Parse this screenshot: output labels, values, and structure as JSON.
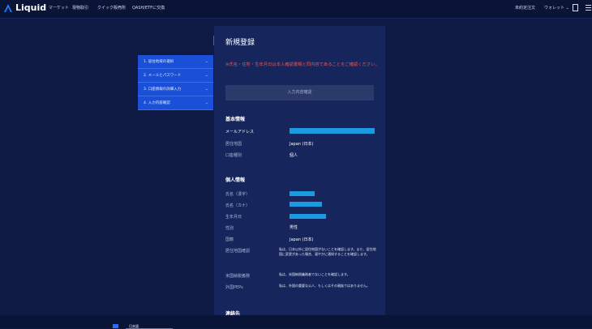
{
  "header": {
    "logo_text": "Liquid",
    "nav": [
      "マーケット",
      "現物取引",
      "クイック販売所",
      "QASH/ETFに交換"
    ],
    "right": {
      "orders": "未約定注文",
      "wallet": "ウォレット"
    }
  },
  "steps": [
    "1. 居住地域の選択",
    "2. メールとパスワード",
    "3. 口座情報の詳細入力",
    "4. 入力内容確認"
  ],
  "form": {
    "title": "新規登録",
    "warning": "※氏名・住所・生年月日は本人確認書類と同内容であることをご確認ください。",
    "confirm_button": "入力内容確認",
    "basic_section": "基本情報",
    "basic": {
      "email_label": "メールアドレス",
      "residence_label": "居住地国",
      "residence_value": "Japan (日本)",
      "account_type_label": "口座種別",
      "account_type_value": "個人"
    },
    "personal_section": "個人情報",
    "personal": {
      "name_kanji_label": "氏名（漢字）",
      "name_kana_label": "氏名（カナ）",
      "birthdate_label": "生年月日",
      "gender_label": "性別",
      "gender_value": "男性",
      "nationality_label": "国籍",
      "nationality_value": "Japan (日本)",
      "residence_confirm_label": "居住地国確認",
      "residence_confirm_text": "私は、日本以外に居住地国がないことを確認します。また、居住地国に変更があった場合、速やかに通知することを確認します。",
      "us_tax_label": "米国納税義務",
      "us_tax_text": "私は、米国納税義務者でないことを確認します。",
      "peps_label": "外国PEPs",
      "peps_text": "私は、外国の重要な公人、もしくはその親族ではありません。"
    },
    "contact_section": "連絡先"
  },
  "footer": {
    "language": "日本語"
  }
}
